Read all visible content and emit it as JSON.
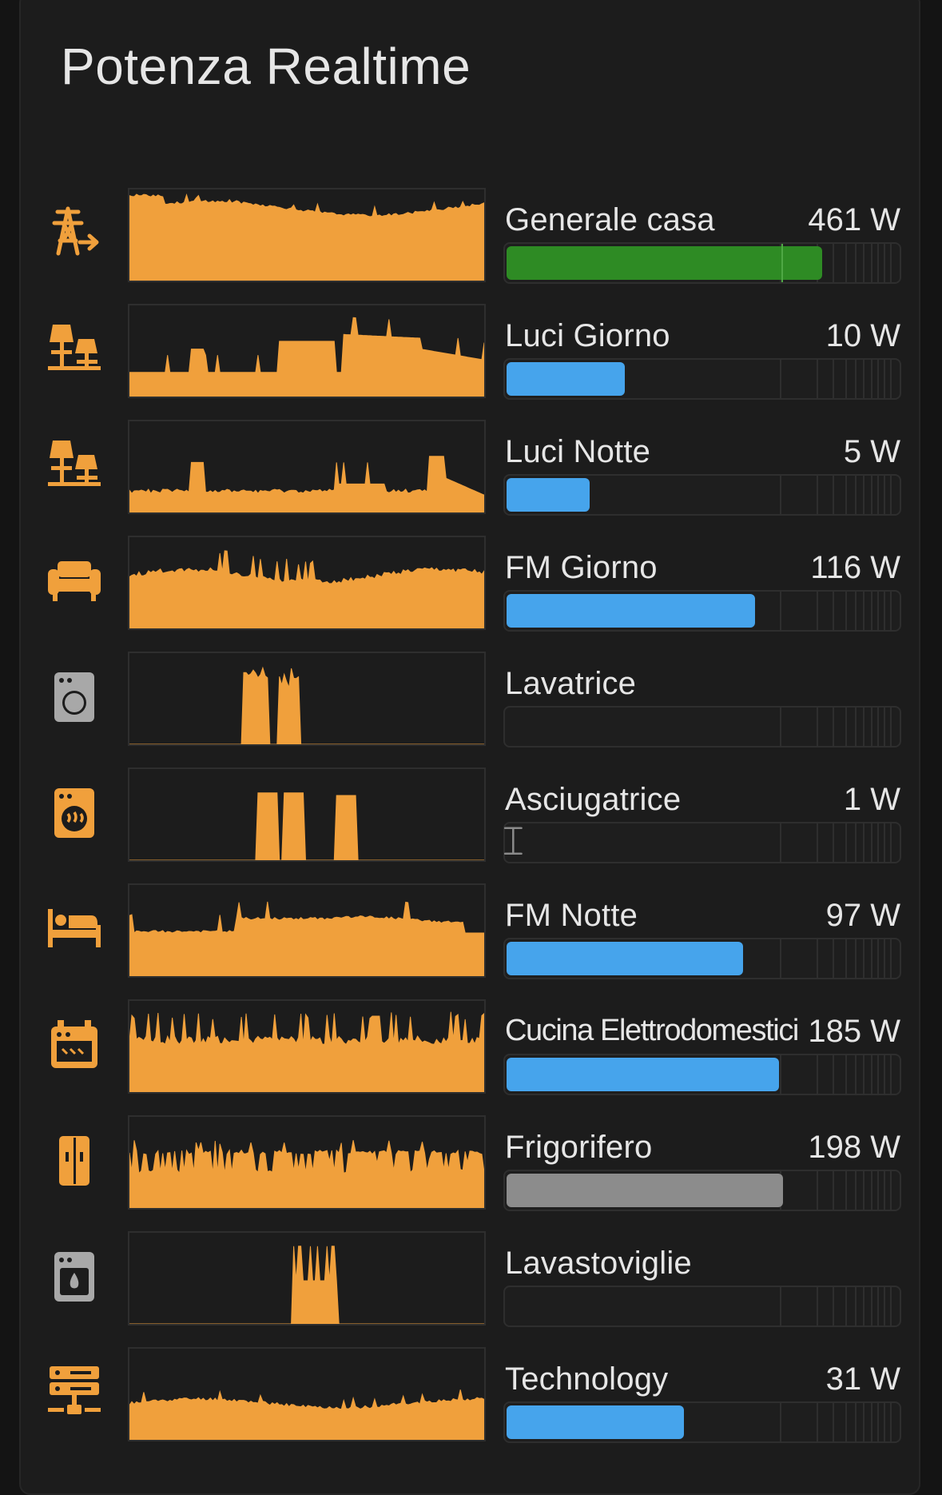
{
  "card": {
    "title": "Potenza Realtime"
  },
  "colors": {
    "icon_active": "#f0a03c",
    "icon_inactive": "#a8a8a8",
    "sparkline": "#f0a03c",
    "bar_total": "#2e8b24",
    "bar_device": "#46a4ec",
    "bar_neutral": "#8c8c8c"
  },
  "rows": [
    {
      "label": "Generale casa",
      "value": "461 W",
      "icon": "transmission-tower-export-icon",
      "bar_fraction": 0.8,
      "bar_color": "#2e8b24",
      "bar_marker": 0.7,
      "spark": "flat-high"
    },
    {
      "label": "Luci Giorno",
      "value": "10 W",
      "icon": "lamps-icon",
      "bar_fraction": 0.3,
      "bar_color": "#46a4ec",
      "spark": "luci-giorno"
    },
    {
      "label": "Luci Notte",
      "value": "5 W",
      "icon": "lamps-icon",
      "bar_fraction": 0.21,
      "bar_color": "#46a4ec",
      "spark": "luci-notte"
    },
    {
      "label": "FM Giorno",
      "value": "116 W",
      "icon": "sofa-icon",
      "bar_fraction": 0.63,
      "bar_color": "#46a4ec",
      "spark": "fm-giorno"
    },
    {
      "label": "Lavatrice",
      "value": "",
      "icon": "washing-machine-icon",
      "bar_fraction": 0,
      "bar_color": "#46a4ec",
      "spark": "lavatrice",
      "inactive": true
    },
    {
      "label": "Asciugatrice",
      "value": "1 W",
      "icon": "tumble-dryer-icon",
      "bar_fraction": 0,
      "bar_color": "#46a4ec",
      "spark": "asciugatrice",
      "cursor": true
    },
    {
      "label": "FM Notte",
      "value": "97 W",
      "icon": "bed-icon",
      "bar_fraction": 0.6,
      "bar_color": "#46a4ec",
      "spark": "fm-notte"
    },
    {
      "label": "Cucina Elettrodomestici",
      "value": "185 W",
      "icon": "stove-icon",
      "bar_fraction": 0.69,
      "bar_color": "#46a4ec",
      "spark": "cucina",
      "narrow": true
    },
    {
      "label": "Frigorifero",
      "value": "198 W",
      "icon": "fridge-icon",
      "bar_fraction": 0.7,
      "bar_color": "#8c8c8c",
      "spark": "frigo"
    },
    {
      "label": "Lavastoviglie",
      "value": "",
      "icon": "dishwasher-icon",
      "bar_fraction": 0,
      "bar_color": "#46a4ec",
      "spark": "lavastoviglie",
      "inactive": true
    },
    {
      "label": "Technology",
      "value": "31 W",
      "icon": "server-network-icon",
      "bar_fraction": 0.45,
      "bar_color": "#46a4ec",
      "spark": "technology"
    }
  ]
}
